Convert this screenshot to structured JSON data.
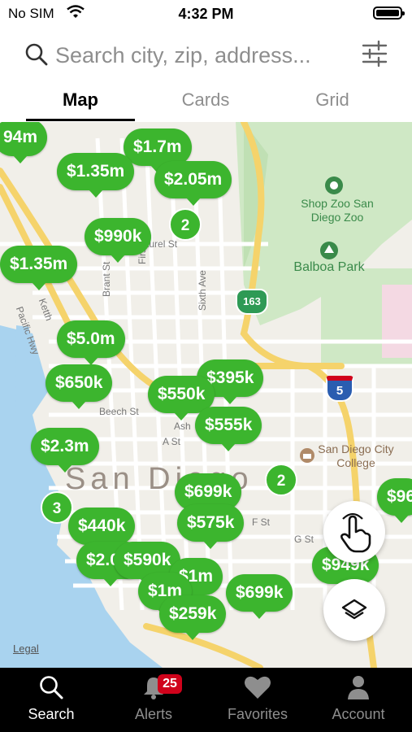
{
  "status_bar": {
    "carrier": "No SIM",
    "time": "4:32 PM"
  },
  "search": {
    "placeholder": "Search city, zip, address..."
  },
  "tabs": [
    {
      "label": "Map"
    },
    {
      "label": "Cards"
    },
    {
      "label": "Grid"
    }
  ],
  "map": {
    "places": {
      "zoo": "Shop Zoo San Diego Zoo",
      "park": "Balboa Park",
      "college": "San Diego City College"
    },
    "city_label": "San Diego",
    "highway_163": "163",
    "highway_5": "5",
    "streets": {
      "laurel": "Laurel St",
      "first": "First Ave",
      "sixth": "Sixth Ave",
      "brant": "Brant St",
      "ketth": "Ketth",
      "pacific": "Pacific Hwy",
      "a_st": "A St",
      "beech": "Beech St",
      "ash": "Ash",
      "f_st": "F St",
      "g_st": "G St"
    },
    "legal": "Legal",
    "prices": [
      "94m",
      "$1.7m",
      "$1.35m",
      "$2.05m",
      "$990k",
      "$1.35m",
      "$5.0m",
      "$650k",
      "$395k",
      "$550k",
      "$555k",
      "$2.3m",
      "$699k",
      "$440k",
      "$575k",
      "$949k",
      "$1m",
      "$699k",
      "$259k",
      "$2.0m",
      "$590k",
      "$1m",
      "$96"
    ],
    "clusters": [
      "2",
      "3",
      "2"
    ]
  },
  "tab_bar": {
    "items": [
      {
        "label": "Search"
      },
      {
        "label": "Alerts"
      },
      {
        "label": "Favorites"
      },
      {
        "label": "Account"
      }
    ],
    "alerts_badge": "25"
  },
  "colors": {
    "pin_green": "#3cb52e",
    "badge_red": "#d0021b"
  }
}
